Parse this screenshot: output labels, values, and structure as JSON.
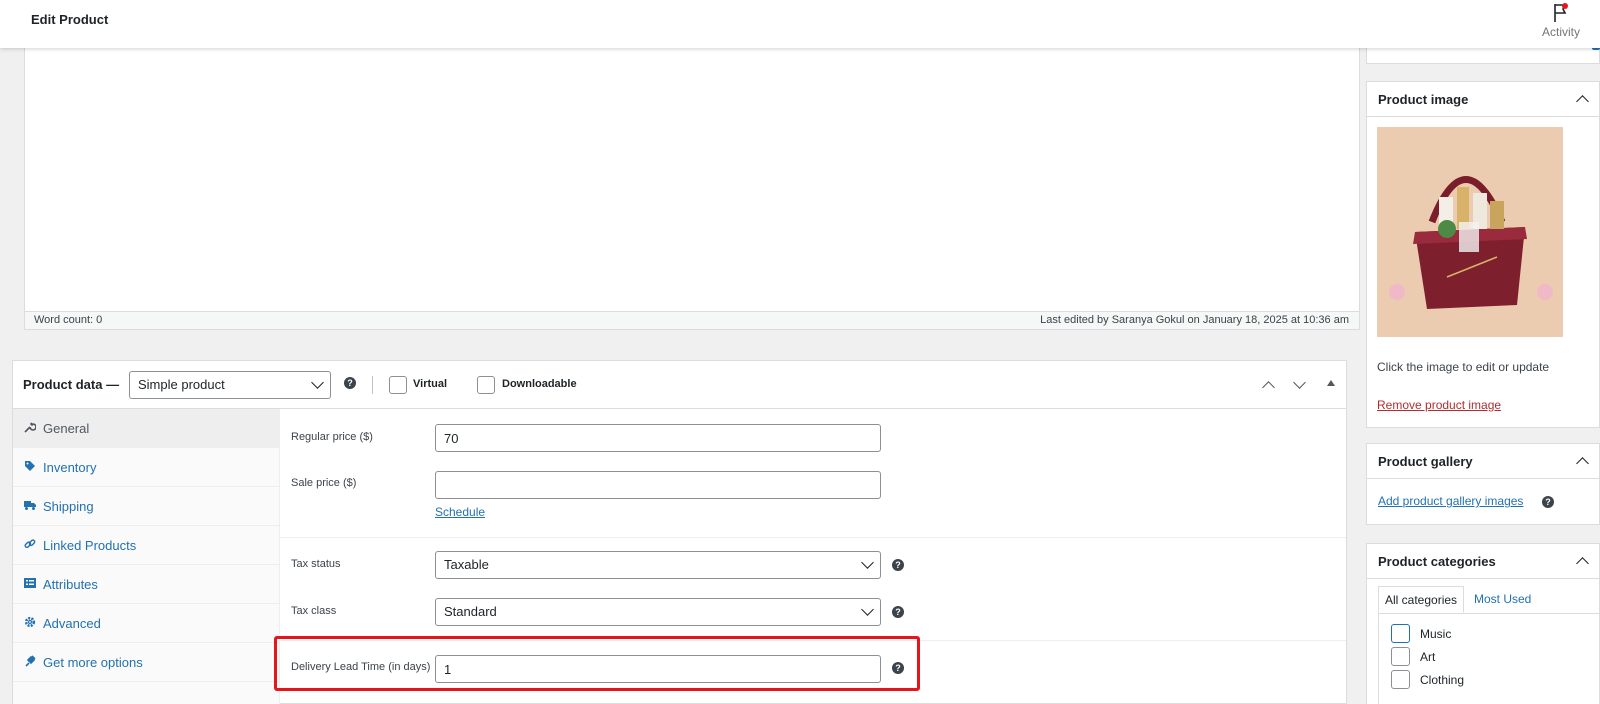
{
  "header": {
    "title": "Edit Product",
    "activity_label": "Activity"
  },
  "editor": {
    "word_count": "Word count: 0",
    "last_edited": "Last edited by Saranya Gokul on January 18, 2025 at 10:36 am"
  },
  "product_data": {
    "title": "Product data —",
    "type_select": "Simple product",
    "virtual_label": "Virtual",
    "downloadable_label": "Downloadable",
    "tabs": [
      {
        "label": "General",
        "icon": "wrench-icon"
      },
      {
        "label": "Inventory",
        "icon": "tag-icon"
      },
      {
        "label": "Shipping",
        "icon": "truck-icon"
      },
      {
        "label": "Linked Products",
        "icon": "link-icon"
      },
      {
        "label": "Attributes",
        "icon": "list-icon"
      },
      {
        "label": "Advanced",
        "icon": "gear-icon"
      },
      {
        "label": "Get more options",
        "icon": "plugin-icon"
      }
    ],
    "fields": {
      "regular_price_label": "Regular price ($)",
      "regular_price_value": "70",
      "sale_price_label": "Sale price ($)",
      "sale_price_value": "",
      "schedule_link": "Schedule",
      "tax_status_label": "Tax status",
      "tax_status_value": "Taxable",
      "tax_class_label": "Tax class",
      "tax_class_value": "Standard",
      "delivery_label": "Delivery Lead Time (in days)",
      "delivery_value": "1"
    }
  },
  "sidebar": {
    "product_image": {
      "title": "Product image",
      "hint": "Click the image to edit or update",
      "remove_link": "Remove product image"
    },
    "product_gallery": {
      "title": "Product gallery",
      "add_link": "Add product gallery images"
    },
    "product_categories": {
      "title": "Product categories",
      "tab_all": "All categories",
      "tab_most_used": "Most Used",
      "items": [
        "Music",
        "Art",
        "Clothing"
      ]
    }
  },
  "colors": {
    "accent": "#2271b1",
    "highlight": "#e8141c",
    "link_remove": "#b32d2e"
  }
}
